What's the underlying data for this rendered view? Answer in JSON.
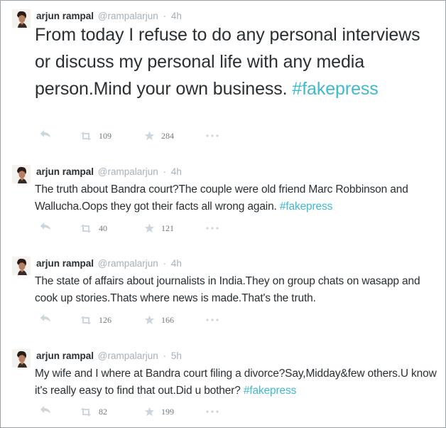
{
  "tweets": [
    {
      "name": "arjun rampal",
      "handle": "@rampalarjun",
      "separator": "·",
      "time": "4h",
      "text_plain": "From today I refuse to do any personal interviews or discuss my personal life with any media person.Mind your own business.",
      "hashtag": "#fakepress",
      "retweets": "109",
      "favorites": "284"
    },
    {
      "name": "arjun rampal",
      "handle": "@rampalarjun",
      "separator": "·",
      "time": "4h",
      "text_plain": "The truth about Bandra court?The couple were old friend Marc Robbinson and Wallucha.Oops they got their facts all wrong again.",
      "hashtag": "#fakepress",
      "retweets": "40",
      "favorites": "121"
    },
    {
      "name": "arjun rampal",
      "handle": "@rampalarjun",
      "separator": "·",
      "time": "4h",
      "text_plain": "The state of affairs about journalists in India.They on group chats on wasapp and cook up stories.Thats where news is made.That's the truth.",
      "hashtag": "",
      "retweets": "126",
      "favorites": "166"
    },
    {
      "name": "arjun rampal",
      "handle": "@rampalarjun",
      "separator": "·",
      "time": "5h",
      "text_plain": "My wife and I where at Bandra court filing a divorce?Say,Midday&few others.U know it's really easy to find that out.Did u bother?",
      "hashtag": "#fakepress",
      "retweets": "82",
      "favorites": "199"
    }
  ],
  "icons": {
    "reply": "reply-icon",
    "retweet": "retweet-icon",
    "favorite": "star-icon",
    "more": "more-icon",
    "avatar": "avatar"
  },
  "colors": {
    "name": "#292f33",
    "meta": "#a6b1b9",
    "hashtag": "#3fb9d1",
    "icon": "#ccd6dd",
    "border": "#9aa3aa"
  }
}
